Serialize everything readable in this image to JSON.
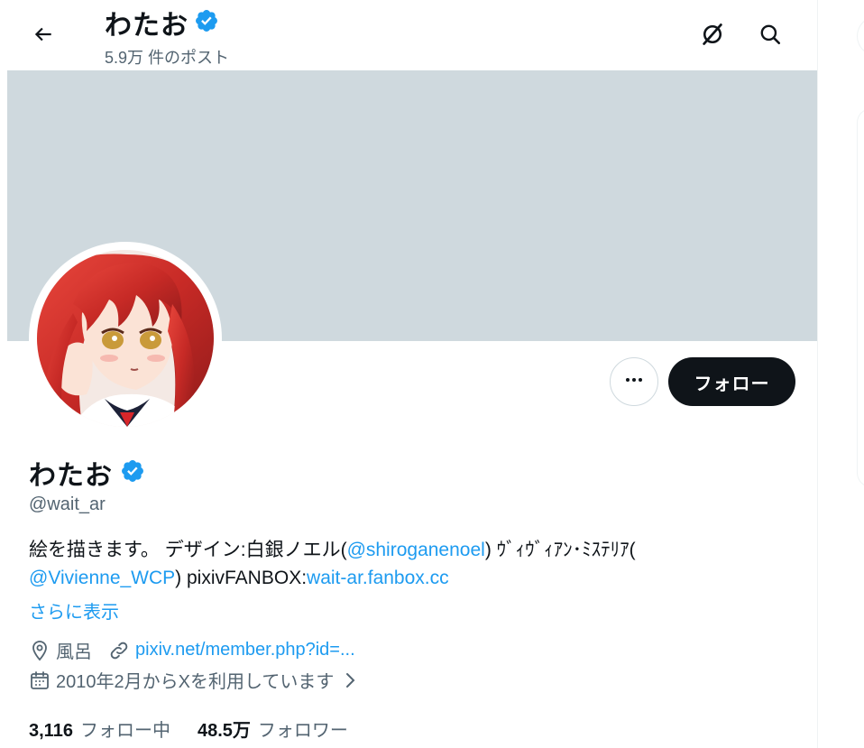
{
  "header": {
    "title": "わたお",
    "post_count": "5.9万 件のポスト"
  },
  "profile": {
    "display_name": "わたお",
    "handle": "@wait_ar",
    "bio": {
      "part1": "絵を描きます。 デザイン:白銀ノエル(",
      "mention1": "@shiroganenoel",
      "part2": ") ｳﾞｨｳﾞｨｱﾝ･ﾐｽﾃﾘｱ(",
      "mention2": "@Vivienne_WCP",
      "part3": ") pixivFANBOX:",
      "link1": "wait-ar.fanbox.cc"
    },
    "show_more": "さらに表示",
    "location": "風呂",
    "website": "pixiv.net/member.php?id=...",
    "joined": "2010年2月からXを利用しています",
    "following_count": "3,116",
    "following_label": "フォロー中",
    "followers_count": "48.5万",
    "followers_label": "フォロワー"
  },
  "actions": {
    "follow_label": "フォロー"
  },
  "icons": {
    "back": "arrow-left-icon",
    "grok": "grok-icon",
    "search": "search-icon",
    "verified": "verified-badge-icon",
    "more": "more-icon",
    "location": "location-pin-icon",
    "link": "link-icon",
    "calendar": "calendar-icon",
    "chevron": "chevron-right-icon"
  },
  "colors": {
    "accent": "#1d9bf0",
    "banner": "#cfd9de",
    "text": "#0f1419",
    "secondary": "#536471"
  }
}
